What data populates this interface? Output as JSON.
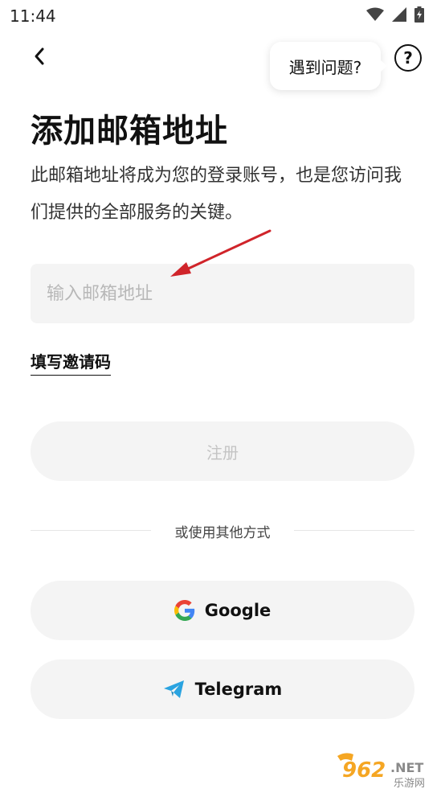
{
  "status_bar": {
    "time": "11:44"
  },
  "header": {
    "help_tooltip": "遇到问题?",
    "help_icon_label": "?"
  },
  "main": {
    "title": "添加邮箱地址",
    "description": "此邮箱地址将成为您的登录账号，也是您访问我们提供的全部服务的关键。",
    "email_placeholder": "输入邮箱地址",
    "invite_link": "填写邀请码",
    "register_label": "注册",
    "divider_text": "或使用其他方式",
    "google_label": "Google",
    "telegram_label": "Telegram"
  },
  "watermark": {
    "number": "962",
    "suffix": ".NET",
    "site": "乐游网"
  },
  "colors": {
    "annotation_arrow": "#d0242a",
    "telegram": "#2aa3e0"
  }
}
